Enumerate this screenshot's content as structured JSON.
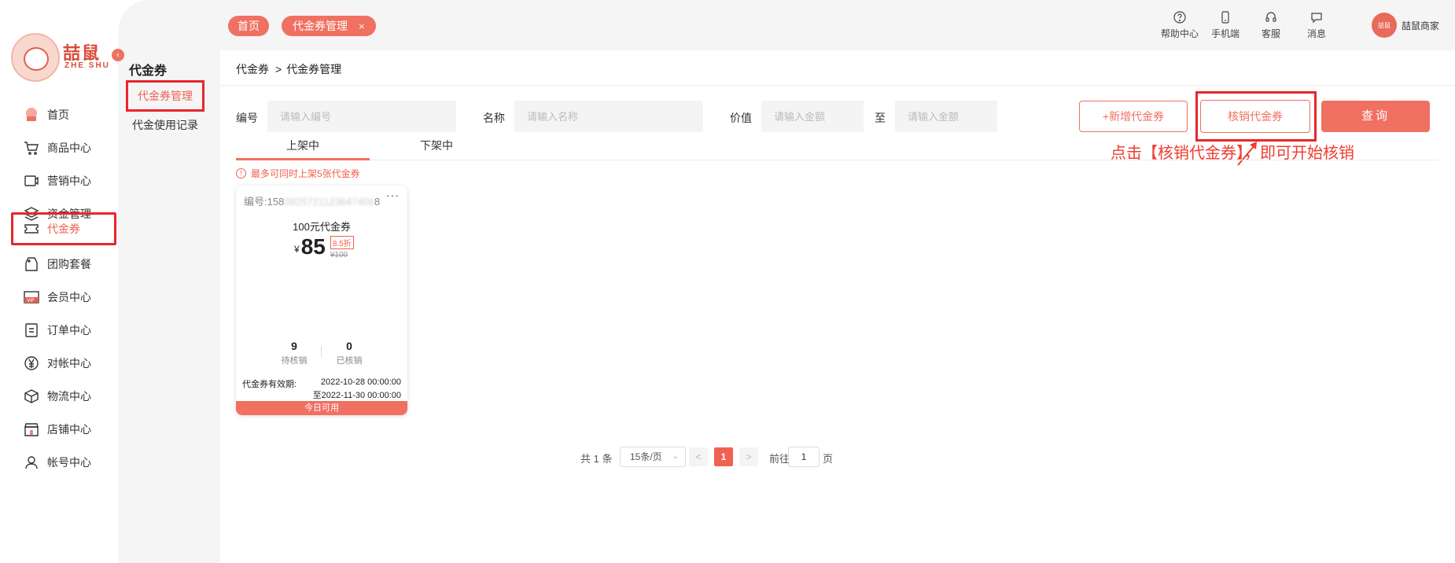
{
  "logo": {
    "text": "喆鼠",
    "sub": "ZHE SHU"
  },
  "nav": [
    {
      "label": "首页",
      "icon": "home-icon"
    },
    {
      "label": "商品中心",
      "icon": "cart-icon"
    },
    {
      "label": "营销中心",
      "icon": "marketing-icon"
    },
    {
      "label": "资金管理",
      "icon": "layers-icon"
    },
    {
      "label": "代金券",
      "icon": "ticket-icon",
      "active": true
    },
    {
      "label": "团购套餐",
      "icon": "bag-icon"
    },
    {
      "label": "会员中心",
      "icon": "vip-icon"
    },
    {
      "label": "订单中心",
      "icon": "order-icon"
    },
    {
      "label": "对帐中心",
      "icon": "yen-icon"
    },
    {
      "label": "物流中心",
      "icon": "box-icon"
    },
    {
      "label": "店铺中心",
      "icon": "store-icon"
    },
    {
      "label": "帐号中心",
      "icon": "user-icon"
    }
  ],
  "subnav": {
    "title": "代金券",
    "items": [
      {
        "label": "代金券管理",
        "active": true
      },
      {
        "label": "代金使用记录"
      }
    ]
  },
  "tabs": {
    "home": "首页",
    "current": "代金券管理",
    "close": "×"
  },
  "header": {
    "help": "帮助中心",
    "mobile": "手机端",
    "service": "客服",
    "message": "消息",
    "user": "喆鼠商家",
    "avatar_text": "喆鼠"
  },
  "breadcrumb": {
    "root": "代金券",
    "sep": ">",
    "current": "代金券管理"
  },
  "filters": {
    "no_label": "编号",
    "no_placeholder": "请输入编号",
    "name_label": "名称",
    "name_placeholder": "请输入名称",
    "value_label": "价值",
    "value_placeholder_from": "请输入金额",
    "value_to": "至",
    "value_placeholder_to": "请输入金额"
  },
  "buttons": {
    "add": "+新增代金券",
    "verify": "核销代金券",
    "query": "查询"
  },
  "annotation": "点击【核销代金券】，即可开始核销",
  "status_tabs": {
    "on": "上架中",
    "off": "下架中"
  },
  "notice": "最多可同时上架5张代金券",
  "coupon": {
    "id_label": "编号:",
    "id_prefix": "158",
    "id_blur": "0925721123647406",
    "id_suffix": "8",
    "more": "···",
    "name": "100元代金券",
    "currency": "¥",
    "price": "85",
    "discount": "8.5折",
    "original": "¥100",
    "pending_count": "9",
    "pending_label": "待核销",
    "verified_count": "0",
    "verified_label": "已核销",
    "valid_label": "代金券有效期:",
    "valid_from": "2022-10-28 00:00:00",
    "valid_to": "至2022-11-30 00:00:00",
    "footer": "今日可用"
  },
  "pagination": {
    "total": "共 1 条",
    "page_size": "15条/页",
    "prev": "<",
    "page": "1",
    "next": ">",
    "goto_label": "前往",
    "goto_value": "1",
    "goto_suffix": "页"
  },
  "colors": {
    "accent": "#f07062",
    "highlight": "#e8262a",
    "annotation": "#ef3b30"
  }
}
